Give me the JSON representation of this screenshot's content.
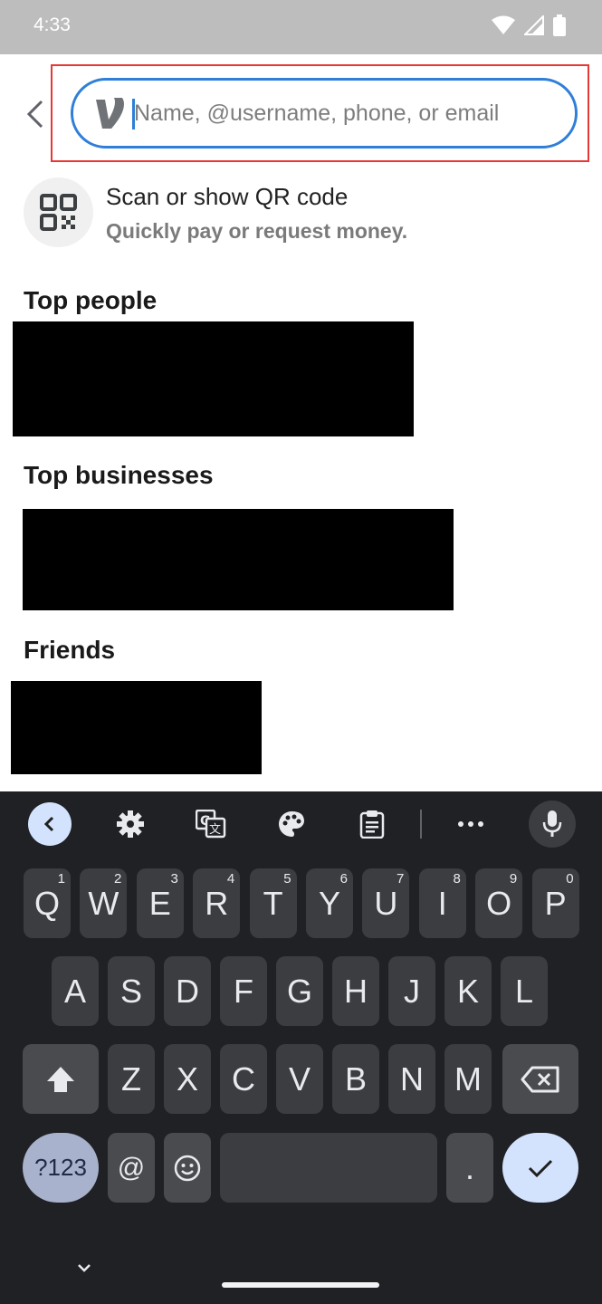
{
  "status_bar": {
    "time": "4:33"
  },
  "search": {
    "placeholder": "Name, @username, phone, or email",
    "value": ""
  },
  "qr": {
    "title": "Scan or show QR code",
    "subtitle": "Quickly pay or request money."
  },
  "sections": {
    "top_people": "Top people",
    "top_businesses": "Top businesses",
    "friends": "Friends"
  },
  "keyboard": {
    "row1": [
      {
        "key": "Q",
        "hint": "1"
      },
      {
        "key": "W",
        "hint": "2"
      },
      {
        "key": "E",
        "hint": "3"
      },
      {
        "key": "R",
        "hint": "4"
      },
      {
        "key": "T",
        "hint": "5"
      },
      {
        "key": "Y",
        "hint": "6"
      },
      {
        "key": "U",
        "hint": "7"
      },
      {
        "key": "I",
        "hint": "8"
      },
      {
        "key": "O",
        "hint": "9"
      },
      {
        "key": "P",
        "hint": "0"
      }
    ],
    "row2": [
      "A",
      "S",
      "D",
      "F",
      "G",
      "H",
      "J",
      "K",
      "L"
    ],
    "row3": [
      "Z",
      "X",
      "C",
      "V",
      "B",
      "N",
      "M"
    ],
    "symbols_label": "?123",
    "at_label": "@",
    "period_label": "."
  },
  "colors": {
    "accent": "#2f7fd8",
    "highlight": "#e53935",
    "keyboard_bg": "#202124",
    "key_bg": "#3c3d40"
  },
  "icons": [
    "back-chevron-icon",
    "venmo-logo-icon",
    "qr-code-icon",
    "keyboard-collapse-icon",
    "settings-icon",
    "translate-icon",
    "palette-icon",
    "clipboard-icon",
    "more-icon",
    "microphone-icon",
    "shift-icon",
    "backspace-icon",
    "emoji-icon",
    "check-icon",
    "hide-keyboard-icon"
  ]
}
